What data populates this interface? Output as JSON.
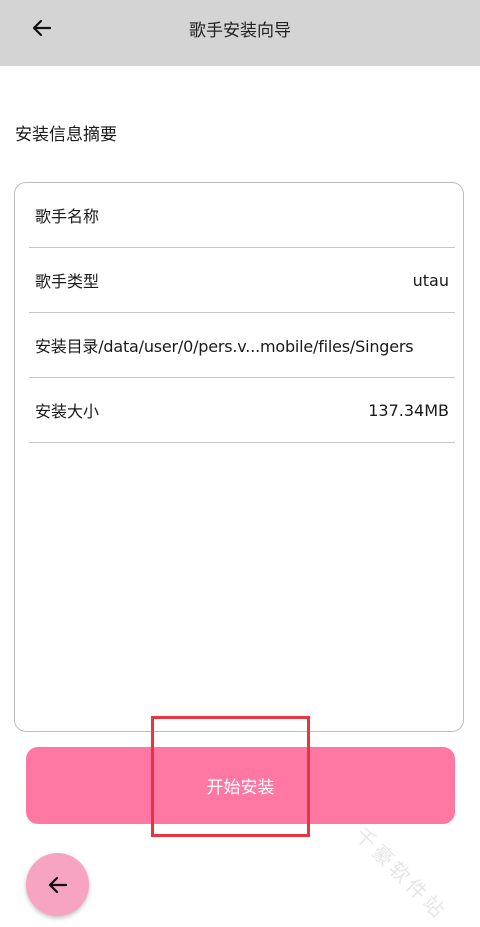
{
  "app_bar": {
    "back_icon": "arrow-left-icon",
    "title": "歌手安装向导"
  },
  "section": {
    "title": "安装信息摘要"
  },
  "summary": {
    "singer_name_label": "歌手名称",
    "singer_name_value": "",
    "singer_type_label": "歌手类型",
    "singer_type_value": "utau",
    "install_dir_label": "安装目录",
    "install_dir_value": "/data/user/0/pers.v...mobile/files/Singers",
    "install_size_label": "安装大小",
    "install_size_value": "137.34MB"
  },
  "install_button": {
    "label": "开始安装"
  },
  "fab": {
    "icon": "arrow-left-icon"
  },
  "watermark": {
    "text": "千豪软件站"
  },
  "colors": {
    "app_bar_bg": "#d4d4d4",
    "install_button_bg": "#ff78a4",
    "fab_bg": "#f7a3c2",
    "highlight_border": "#e8353f"
  }
}
